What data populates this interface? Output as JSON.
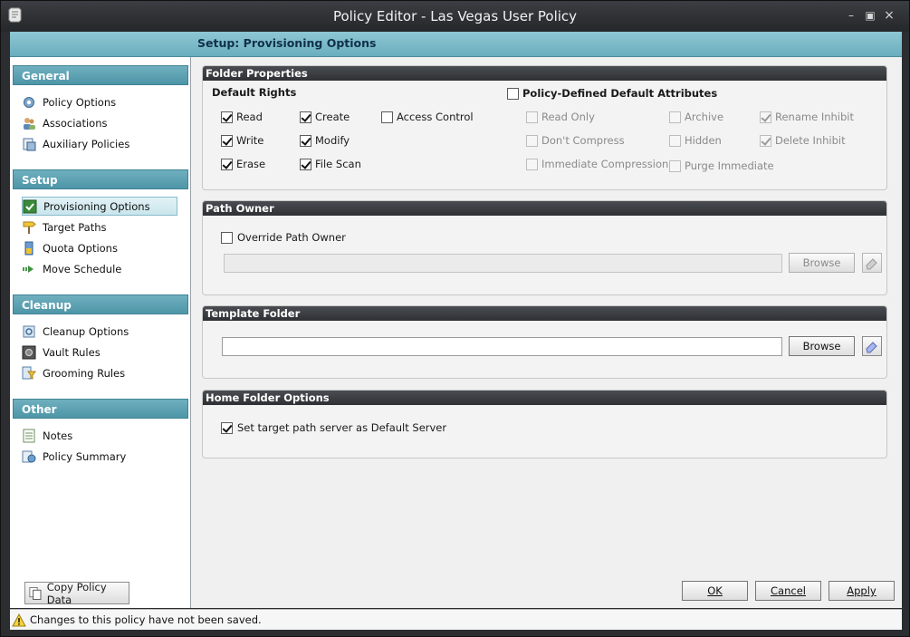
{
  "window": {
    "title": "Policy Editor - Las Vegas User Policy",
    "header": "Setup: Provisioning Options"
  },
  "sidebar": {
    "sections": [
      {
        "title": "General",
        "items": [
          "Policy Options",
          "Associations",
          "Auxiliary Policies"
        ]
      },
      {
        "title": "Setup",
        "items": [
          "Provisioning Options",
          "Target Paths",
          "Quota Options",
          "Move Schedule"
        ]
      },
      {
        "title": "Cleanup",
        "items": [
          "Cleanup Options",
          "Vault Rules",
          "Grooming Rules"
        ]
      },
      {
        "title": "Other",
        "items": [
          "Notes",
          "Policy Summary"
        ]
      }
    ],
    "selected": "Provisioning Options",
    "copy_button": "Copy Policy Data"
  },
  "folder_properties": {
    "title": "Folder Properties",
    "default_rights_label": "Default Rights",
    "rights": {
      "read": {
        "label": "Read",
        "checked": true
      },
      "create": {
        "label": "Create",
        "checked": true
      },
      "access_control": {
        "label": "Access Control",
        "checked": false
      },
      "write": {
        "label": "Write",
        "checked": true
      },
      "modify": {
        "label": "Modify",
        "checked": true
      },
      "erase": {
        "label": "Erase",
        "checked": true
      },
      "file_scan": {
        "label": "File Scan",
        "checked": true
      }
    },
    "policy_defined": {
      "label": "Policy-Defined Default Attributes",
      "checked": false
    },
    "attributes": {
      "read_only": {
        "label": "Read Only",
        "checked": false
      },
      "archive": {
        "label": "Archive",
        "checked": false
      },
      "rename_inhibit": {
        "label": "Rename Inhibit",
        "checked": true
      },
      "dont_compress": {
        "label": "Don't Compress",
        "checked": false
      },
      "hidden": {
        "label": "Hidden",
        "checked": false
      },
      "delete_inhibit": {
        "label": "Delete Inhibit",
        "checked": true
      },
      "immediate_compression": {
        "label": "Immediate Compression",
        "checked": false
      },
      "purge_immediate": {
        "label": "Purge Immediate",
        "checked": false
      }
    }
  },
  "path_owner": {
    "title": "Path Owner",
    "override_label": "Override Path Owner",
    "override_checked": false,
    "value": "",
    "browse_label": "Browse"
  },
  "template_folder": {
    "title": "Template Folder",
    "value": "",
    "browse_label": "Browse"
  },
  "home_folder": {
    "title": "Home Folder Options",
    "default_server_label": "Set target path server as Default Server",
    "default_server_checked": true
  },
  "footer": {
    "ok": "OK",
    "cancel": "Cancel",
    "apply": "Apply"
  },
  "status": {
    "message": "Changes to this policy have not been saved."
  },
  "colors": {
    "section_header": "#5aa0b2",
    "panel_header": "#3a3c40",
    "title_bar": "#2f3236"
  }
}
